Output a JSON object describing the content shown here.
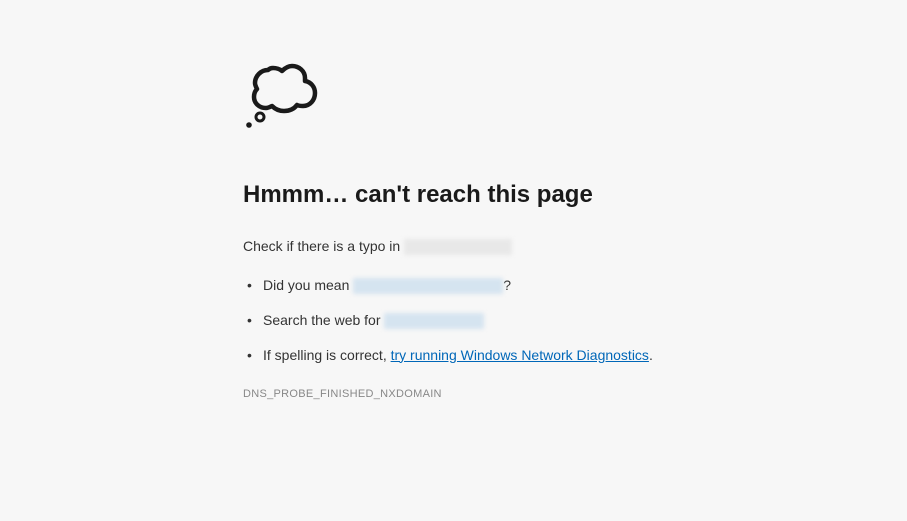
{
  "error": {
    "title": "Hmmm… can't reach this page",
    "description_prefix": "Check if there is a typo in ",
    "suggestions": {
      "did_you_mean_prefix": "Did you mean ",
      "did_you_mean_suffix": "?",
      "search_web_prefix": "Search the web for ",
      "spelling_prefix": "If spelling is correct, ",
      "diagnostics_link": "try running Windows Network Diagnostics",
      "spelling_suffix": "."
    },
    "code": "DNS_PROBE_FINISHED_NXDOMAIN"
  }
}
